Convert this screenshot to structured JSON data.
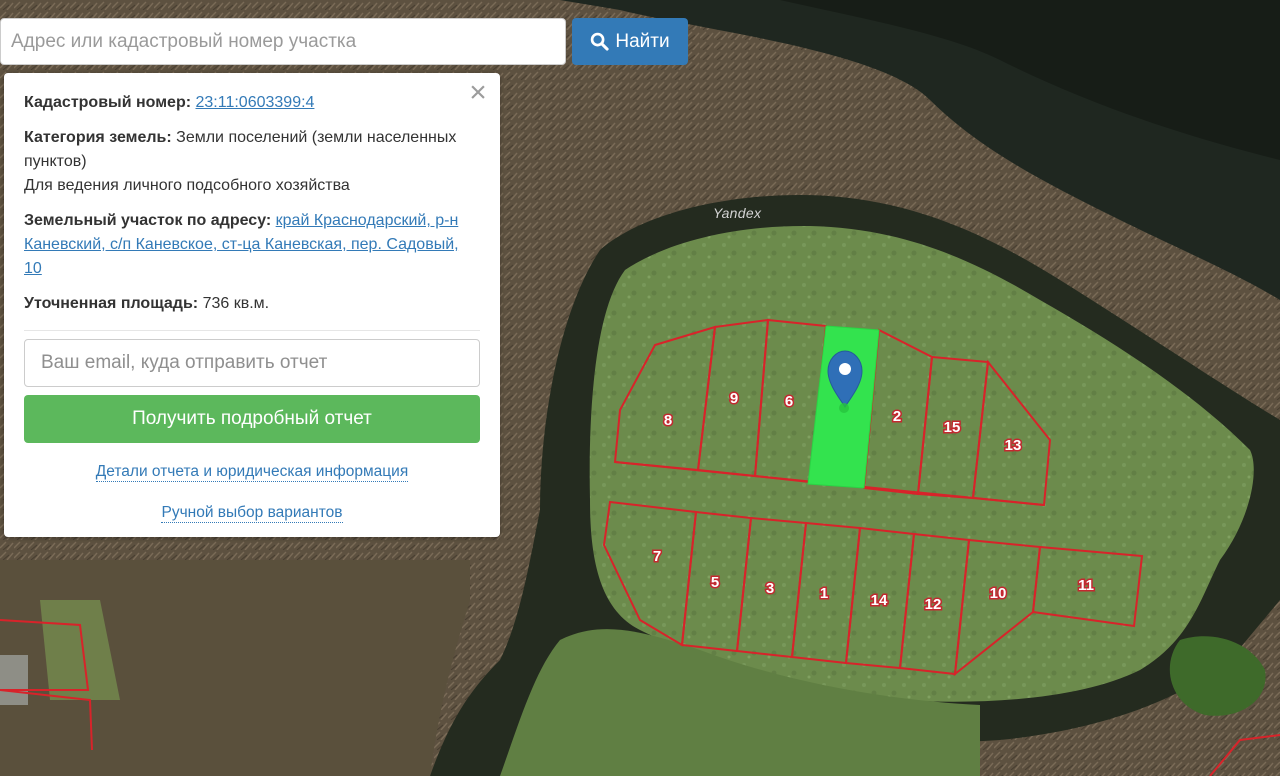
{
  "search": {
    "placeholder": "Адрес или кадастровый номер участка",
    "value": "",
    "button_label": "Найти",
    "button_icon": "search-icon"
  },
  "info": {
    "cadastral_label": "Кадастровый номер:",
    "cadastral_number": "23:11:0603399:4",
    "category_label": "Категория земель:",
    "category_value": "Земли поселений (земли населенных пунктов)",
    "usage_value": "Для ведения личного подсобного хозяйства",
    "address_label": "Земельный участок по адресу:",
    "address_value": "край Краснодарский, р-н Каневский, с/п Каневское, ст-ца Каневская, пер. Садовый, 10",
    "area_label": "Уточненная площадь:",
    "area_value": "736 кв.м.",
    "close_icon": "×"
  },
  "report": {
    "email_placeholder": "Ваш email, куда отправить отчет",
    "button_label": "Получить подробный отчет",
    "details_link": "Детали отчета и юридическая информация",
    "manual_link": "Ручной выбор вариантов"
  },
  "map": {
    "watermark": "Yandex",
    "parcel_labels": [
      "8",
      "9",
      "6",
      "2",
      "15",
      "13",
      "7",
      "5",
      "3",
      "1",
      "14",
      "12",
      "10",
      "11"
    ],
    "colors": {
      "selected_parcel": "#35e04f",
      "parcel_border": "#e0202a",
      "marker": "#2f6fb7",
      "water": "#1c2319",
      "grass": "#6f8f4e"
    }
  }
}
